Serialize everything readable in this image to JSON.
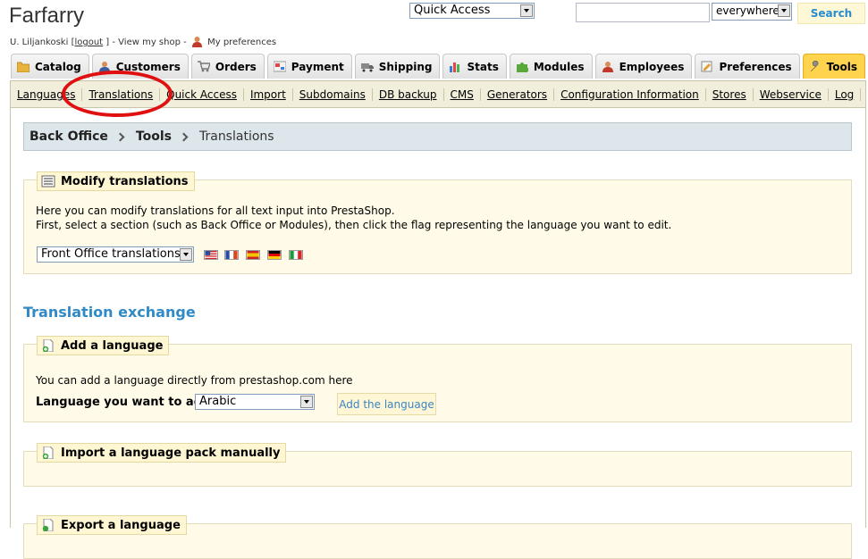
{
  "header": {
    "shop_name": "Farfarry",
    "user_name": "U. Liljankoski",
    "logout_open": "[",
    "logout_label": "logout",
    "logout_close": "] - View my shop -",
    "preferences_label": "My preferences",
    "quick_access": "Quick Access",
    "search_value": "",
    "search_scope": "everywhere",
    "search_button": "Search"
  },
  "tabs": [
    {
      "label": "Catalog",
      "icon": "folder-icon"
    },
    {
      "label": "Customers",
      "icon": "customer-icon"
    },
    {
      "label": "Orders",
      "icon": "cart-icon"
    },
    {
      "label": "Payment",
      "icon": "payment-icon"
    },
    {
      "label": "Shipping",
      "icon": "truck-icon"
    },
    {
      "label": "Stats",
      "icon": "chart-icon"
    },
    {
      "label": "Modules",
      "icon": "puzzle-icon"
    },
    {
      "label": "Employees",
      "icon": "employee-icon"
    },
    {
      "label": "Preferences",
      "icon": "preferences-icon"
    },
    {
      "label": "Tools",
      "icon": "wrench-icon",
      "active": true
    }
  ],
  "subnav": [
    "Languages",
    "Translations",
    "Quick Access",
    "Import",
    "Subdomains",
    "DB backup",
    "CMS",
    "Generators",
    "Configuration Information",
    "Stores",
    "Webservice",
    "Log"
  ],
  "breadcrumb": {
    "root": "Back Office",
    "parent": "Tools",
    "current": "Translations"
  },
  "modify": {
    "title": "Modify translations",
    "line1": "Here you can modify translations for all text input into PrestaShop.",
    "line2": "First, select a section (such as Back Office or Modules), then click the flag representing the language you want to edit.",
    "section_value": "Front Office translations",
    "flags": [
      "flag-us-icon",
      "flag-fr-icon",
      "flag-es-icon",
      "flag-de-icon",
      "flag-it-icon"
    ]
  },
  "exchange_heading": "Translation exchange",
  "add_language": {
    "title": "Add a language",
    "text": "You can add a language directly from prestashop.com here",
    "field_label": "Language you want to add:",
    "field_value": "Arabic",
    "button": "Add the language"
  },
  "import_pack": {
    "title": "Import a language pack manually"
  },
  "export_language": {
    "title": "Export a language"
  },
  "colors": {
    "accent": "#2f8ac7",
    "active_tab": "#ffd34d",
    "annotation": "#e01010"
  }
}
